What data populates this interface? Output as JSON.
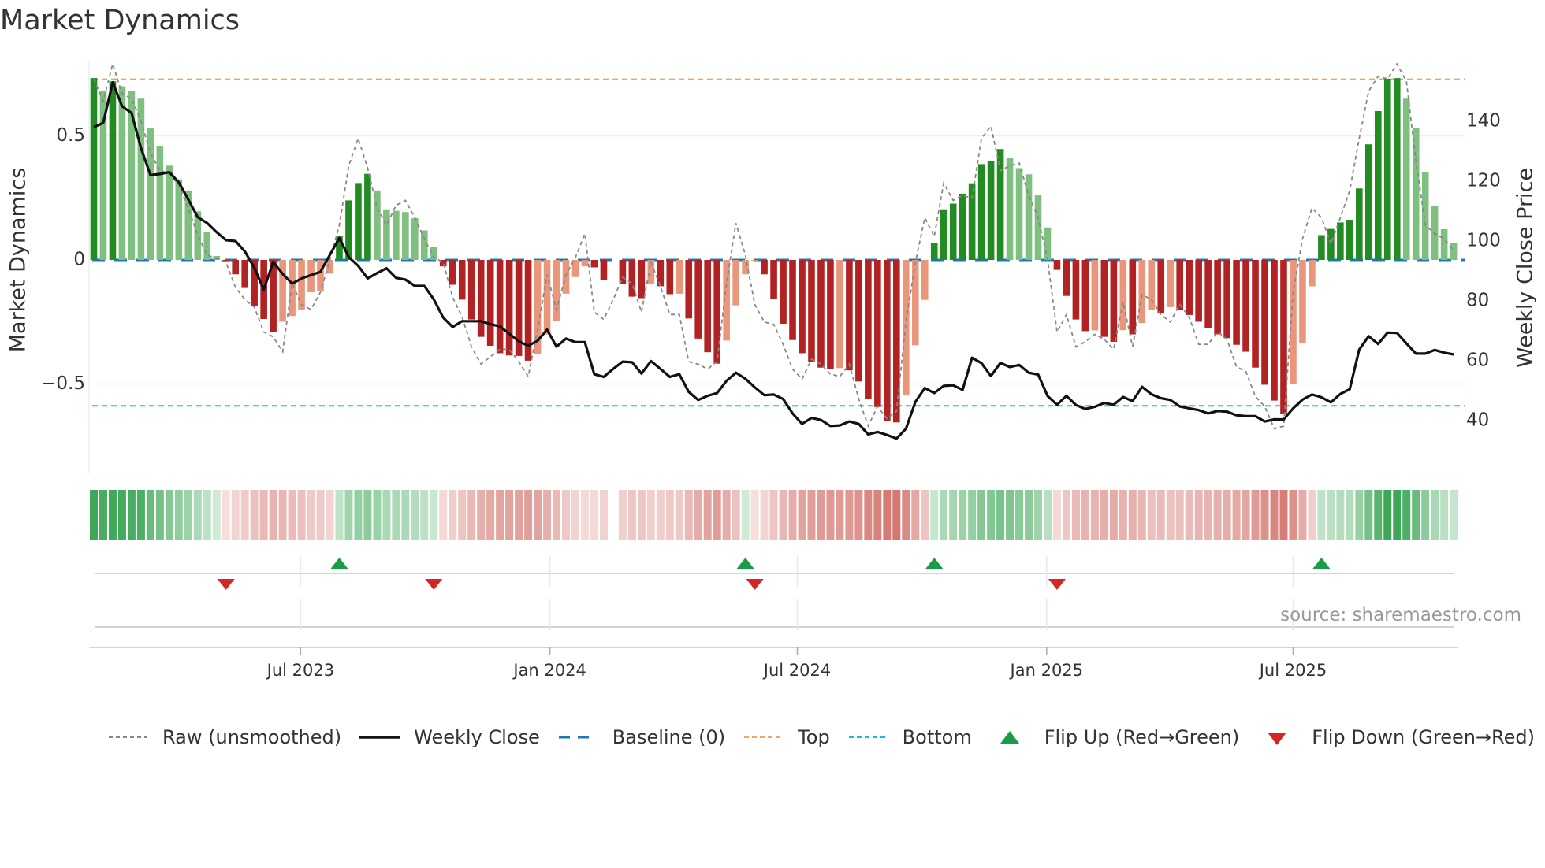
{
  "chart_data": {
    "type": "bar",
    "title": "Market Dynamics",
    "ylabel": "Market Dynamics",
    "y2label": "Weekly Close Price",
    "ylim": [
      -0.82,
      0.8
    ],
    "y2lim": [
      28,
      170
    ],
    "yticks": [
      {
        "v": 0.5,
        "label": "0.5"
      },
      {
        "v": 0,
        "label": "0"
      },
      {
        "v": -0.5,
        "label": "−0.5"
      }
    ],
    "y2ticks": [
      {
        "v": 140,
        "label": "140"
      },
      {
        "v": 120,
        "label": "120"
      },
      {
        "v": 100,
        "label": "100"
      },
      {
        "v": 80,
        "label": "80"
      },
      {
        "v": 60,
        "label": "60"
      },
      {
        "v": 40,
        "label": "40"
      }
    ],
    "x_unit": "week index (weekly bars)",
    "xticks": [
      {
        "week": 21.9,
        "label": "Jul 2023"
      },
      {
        "week": 48.3,
        "label": "Jan 2024"
      },
      {
        "week": 74.5,
        "label": "Jul 2024"
      },
      {
        "week": 100.9,
        "label": "Jan 2025"
      },
      {
        "week": 127,
        "label": "Jul 2025"
      }
    ],
    "levels": {
      "baseline": 0,
      "top": 0.728,
      "bottom": -0.588
    },
    "series": [
      {
        "name": "Market Dynamics (smoothed)",
        "kind": "bar",
        "values": [
          0.733,
          0.68,
          0.72,
          0.7,
          0.68,
          0.65,
          0.53,
          0.46,
          0.38,
          0.325,
          0.28,
          0.196,
          0.112,
          0.016,
          -0.005,
          -0.058,
          -0.113,
          -0.187,
          -0.238,
          -0.29,
          -0.249,
          -0.226,
          -0.2,
          -0.13,
          -0.127,
          -0.055,
          0.095,
          0.24,
          0.31,
          0.347,
          0.28,
          0.204,
          0.198,
          0.193,
          0.168,
          0.119,
          0.053,
          -0.026,
          -0.1,
          -0.16,
          -0.24,
          -0.31,
          -0.346,
          -0.376,
          -0.385,
          -0.387,
          -0.406,
          -0.378,
          -0.3,
          -0.246,
          -0.136,
          -0.069,
          -0.026,
          -0.03,
          -0.08,
          0,
          -0.098,
          -0.148,
          -0.154,
          -0.095,
          -0.106,
          -0.138,
          -0.136,
          -0.236,
          -0.317,
          -0.372,
          -0.418,
          -0.325,
          -0.183,
          -0.058,
          -0.003,
          -0.058,
          -0.157,
          -0.257,
          -0.323,
          -0.376,
          -0.41,
          -0.434,
          -0.44,
          -0.436,
          -0.445,
          -0.49,
          -0.56,
          -0.593,
          -0.65,
          -0.655,
          -0.543,
          -0.344,
          -0.161,
          0.069,
          0.204,
          0.227,
          0.267,
          0.309,
          0.386,
          0.397,
          0.447,
          0.41,
          0.37,
          0.345,
          0.26,
          0.131,
          -0.04,
          -0.145,
          -0.24,
          -0.287,
          -0.284,
          -0.31,
          -0.33,
          -0.283,
          -0.3,
          -0.254,
          -0.2,
          -0.216,
          -0.19,
          -0.2,
          -0.222,
          -0.249,
          -0.275,
          -0.3,
          -0.315,
          -0.342,
          -0.37,
          -0.434,
          -0.503,
          -0.567,
          -0.62,
          -0.5,
          -0.336,
          -0.106,
          0.1,
          0.125,
          0.151,
          0.162,
          0.288,
          0.466,
          0.6,
          0.73,
          0.733,
          0.65,
          0.533,
          0.355,
          0.216,
          0.124,
          0.068
        ]
      },
      {
        "name": "Raw (unsmoothed)",
        "kind": "line",
        "values": [
          0.73,
          0.64,
          0.79,
          0.67,
          0.65,
          0.56,
          0.43,
          0.36,
          0.35,
          0.3,
          0.21,
          0.1,
          0.02,
          0.005,
          -0.01,
          -0.11,
          -0.16,
          -0.19,
          -0.29,
          -0.31,
          -0.37,
          -0.095,
          -0.18,
          -0.2,
          -0.13,
          0,
          0.14,
          0.38,
          0.49,
          0.37,
          0.21,
          0.14,
          0.22,
          0.24,
          0.17,
          0.085,
          0.01,
          -0.01,
          -0.15,
          -0.23,
          -0.35,
          -0.42,
          -0.39,
          -0.36,
          -0.36,
          -0.41,
          -0.47,
          -0.28,
          -0.06,
          -0.2,
          -0.06,
          0.01,
          0.106,
          -0.21,
          -0.24,
          -0.16,
          -0.07,
          -0.095,
          -0.21,
          -0.01,
          -0.106,
          -0.22,
          -0.22,
          -0.41,
          -0.42,
          -0.44,
          -0.41,
          -0.095,
          0.148,
          0.02,
          -0.18,
          -0.25,
          -0.26,
          -0.34,
          -0.44,
          -0.48,
          -0.4,
          -0.42,
          -0.46,
          -0.47,
          -0.42,
          -0.56,
          -0.67,
          -0.59,
          -0.64,
          -0.61,
          -0.25,
          -0.01,
          0.17,
          0.095,
          0.31,
          0.24,
          0.26,
          0.25,
          0.49,
          0.54,
          0.36,
          0.38,
          0.39,
          0.26,
          0.17,
          0,
          -0.29,
          -0.22,
          -0.35,
          -0.33,
          -0.3,
          -0.32,
          -0.36,
          -0.17,
          -0.35,
          -0.14,
          -0.16,
          -0.22,
          -0.25,
          -0.18,
          -0.23,
          -0.34,
          -0.34,
          -0.29,
          -0.32,
          -0.43,
          -0.45,
          -0.55,
          -0.59,
          -0.68,
          -0.67,
          -0.13,
          0.085,
          0.21,
          0.17,
          0.064,
          0.17,
          0.28,
          0.49,
          0.68,
          0.74,
          0.73,
          0.79,
          0.72,
          0.4,
          0.14,
          0.106,
          0.085,
          0.037
        ]
      },
      {
        "name": "Weekly Close",
        "kind": "line",
        "axis": "right",
        "values": [
          138,
          139.5,
          153,
          145,
          142.8,
          131,
          122,
          122.4,
          123,
          119.6,
          113.9,
          108,
          106,
          103,
          100.3,
          100,
          96.5,
          91,
          83.8,
          93,
          89,
          85.8,
          87.5,
          88.6,
          89.7,
          95.4,
          101,
          94.6,
          91.7,
          87.5,
          89.3,
          90.9,
          87.7,
          87.1,
          85,
          85,
          80.5,
          74.4,
          71.3,
          73.2,
          73.2,
          73.2,
          72.2,
          71.5,
          69,
          66.5,
          65,
          66.7,
          70.4,
          64.7,
          67.4,
          66.2,
          66.2,
          55.5,
          54.6,
          57.3,
          59.7,
          59.5,
          55.7,
          59.9,
          57.3,
          54.6,
          55.5,
          49.6,
          46.9,
          48.3,
          49.2,
          53.3,
          56,
          54,
          51.1,
          48.5,
          48.7,
          47.2,
          42.4,
          38.9,
          40.9,
          40.2,
          38.2,
          38.4,
          39.7,
          38.9,
          35.4,
          36.2,
          35.2,
          34,
          37.3,
          46.3,
          50.9,
          49.2,
          51.6,
          51.8,
          50.3,
          61,
          59.2,
          54.9,
          59.3,
          57.9,
          58.6,
          56,
          55.4,
          48.2,
          45.3,
          48.3,
          45.2,
          43.9,
          44.6,
          45.9,
          45.3,
          47.9,
          46.5,
          51.3,
          48.8,
          47.5,
          46.9,
          44.7,
          44.1,
          43.5,
          42.4,
          43.2,
          43,
          41.8,
          41.5,
          41.5,
          39.7,
          40.4,
          40.4,
          44.1,
          47,
          48.7,
          47.8,
          46.1,
          48.9,
          50.5,
          63.7,
          68.2,
          65.6,
          69.4,
          69.3,
          65.8,
          62.4,
          62.4,
          63.6,
          62.7,
          62.1
        ]
      }
    ],
    "regime_strip_overrides": {
      "69": 0.02
    },
    "flips": {
      "up_weeks": [
        26,
        69,
        89,
        130
      ],
      "down_weeks": [
        14,
        36,
        70,
        102
      ]
    },
    "legend": {
      "position": "bottom",
      "items": [
        "Raw (unsmoothed)",
        "Weekly Close",
        "Baseline (0)",
        "Top",
        "Bottom",
        "Flip Up (Red→Green)",
        "Flip Down (Green→Red)"
      ]
    },
    "source": "source: sharemaestro.com",
    "colors": {
      "strong_up": "#228b22",
      "weak_up": "#7fbf7f",
      "strong_down": "#b22222",
      "weak_down": "#e9967a",
      "baseline": "#1f77b4",
      "top": "#f4a261",
      "bottom": "#17becf",
      "close": "#111111",
      "raw": "#888888",
      "flip_up": "#1a9c47",
      "flip_down": "#d62728"
    }
  }
}
